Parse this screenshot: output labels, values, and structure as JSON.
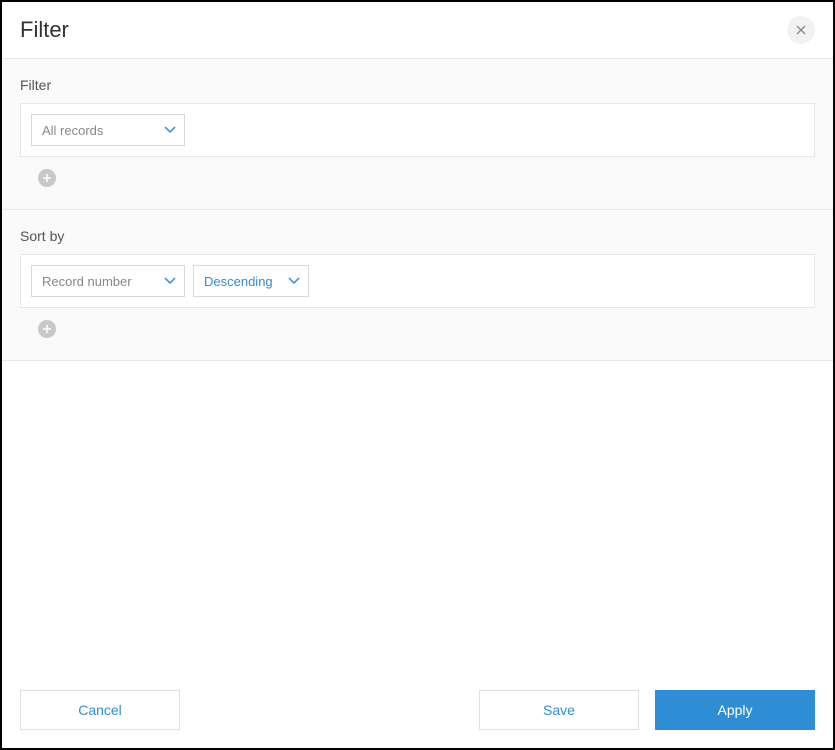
{
  "header": {
    "title": "Filter"
  },
  "filter_section": {
    "label": "Filter",
    "select_value": "All records"
  },
  "sort_section": {
    "label": "Sort by",
    "field_value": "Record number",
    "direction_value": "Descending"
  },
  "footer": {
    "cancel_label": "Cancel",
    "save_label": "Save",
    "apply_label": "Apply"
  }
}
